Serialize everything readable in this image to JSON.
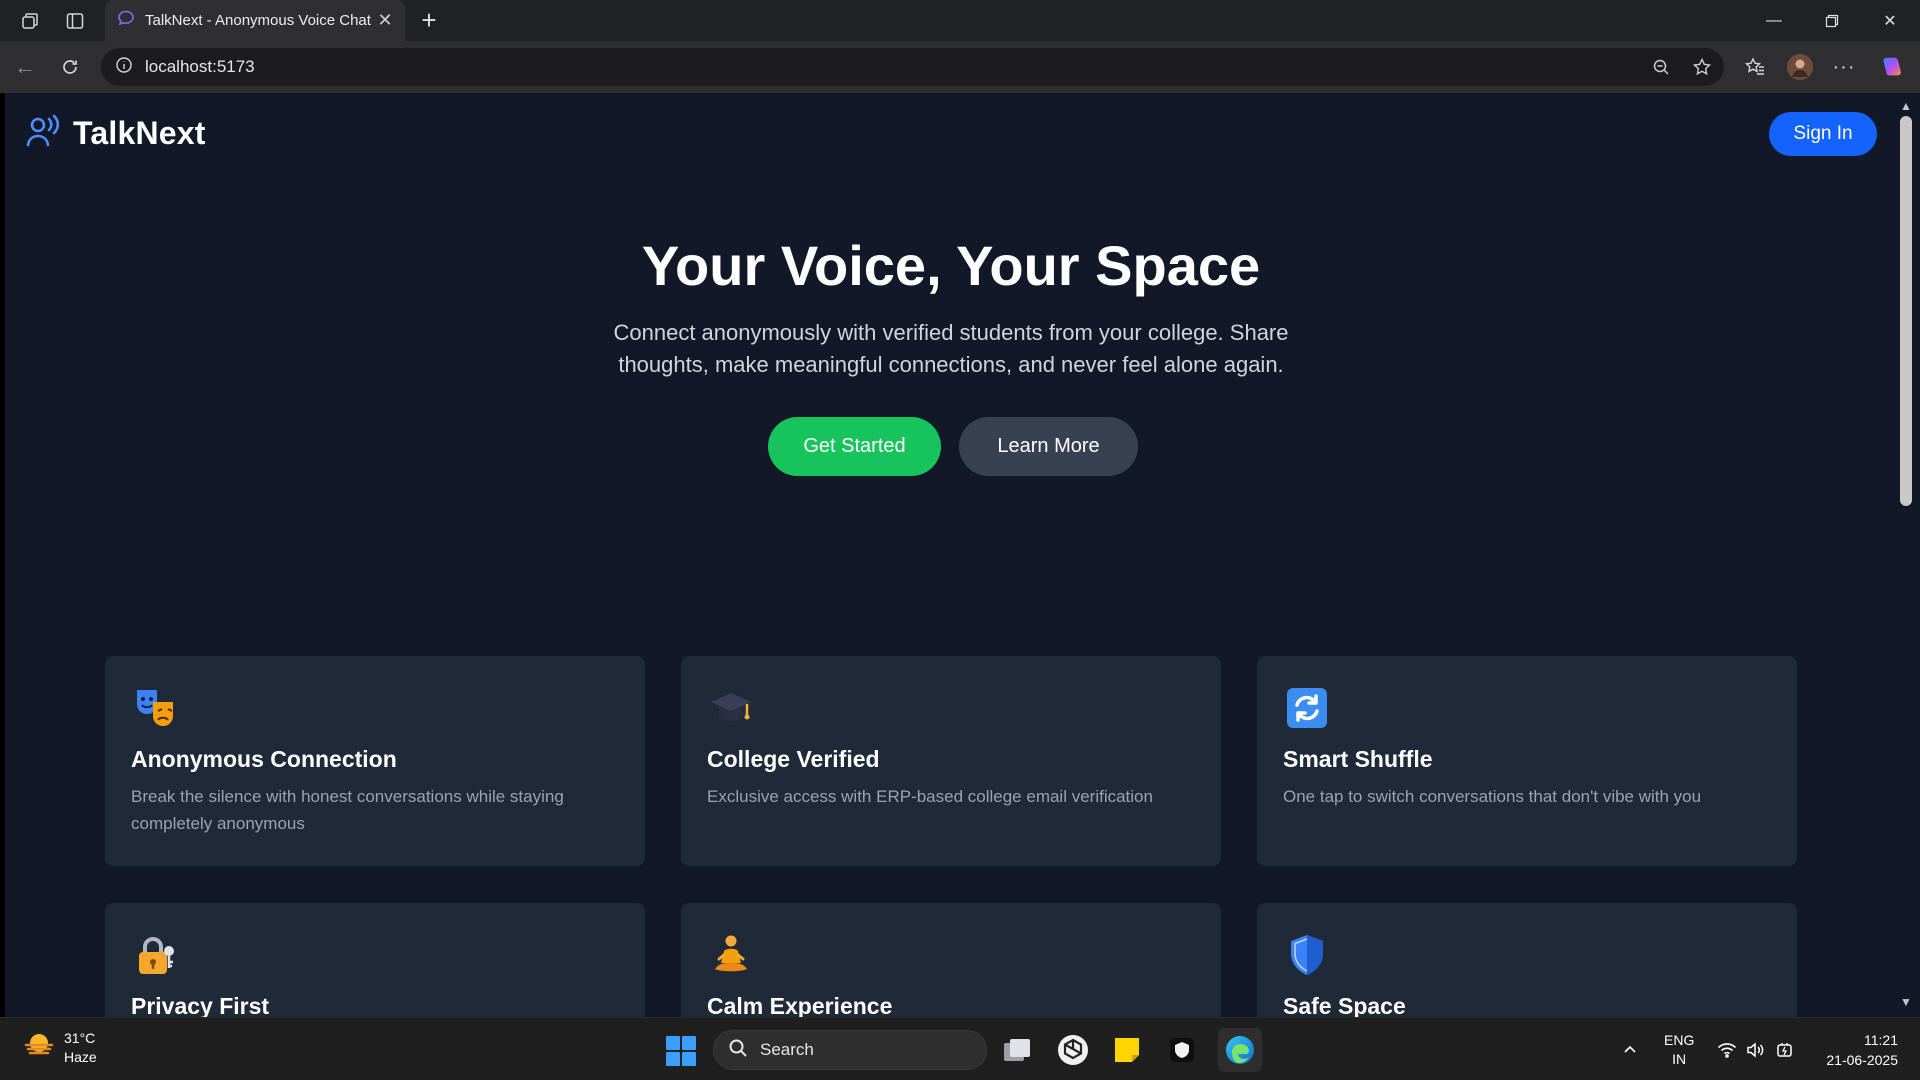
{
  "browser": {
    "tab_title": "TalkNext - Anonymous Voice Chat",
    "url": "localhost:5173"
  },
  "page": {
    "brand": "TalkNext",
    "sign_in_label": "Sign In",
    "hero": {
      "title": "Your Voice, Your Space",
      "subtitle": "Connect anonymously with verified students from your college. Share thoughts, make meaningful connections, and never feel alone again.",
      "primary_cta": "Get Started",
      "secondary_cta": "Learn More"
    },
    "features": [
      {
        "icon": "theater-masks-icon",
        "title": "Anonymous Connection",
        "description": "Break the silence with honest conversations while staying completely anonymous"
      },
      {
        "icon": "graduation-cap-icon",
        "title": "College Verified",
        "description": "Exclusive access with ERP-based college email verification"
      },
      {
        "icon": "shuffle-icon",
        "title": "Smart Shuffle",
        "description": "One tap to switch conversations that don't vibe with you"
      },
      {
        "icon": "lock-icon",
        "title": "Privacy First",
        "description": ""
      },
      {
        "icon": "meditation-icon",
        "title": "Calm Experience",
        "description": ""
      },
      {
        "icon": "shield-icon",
        "title": "Safe Space",
        "description": ""
      }
    ],
    "colors": {
      "background": "#111827",
      "card": "#1f2937",
      "primary": "#1463ff",
      "success": "#16c45b"
    }
  },
  "taskbar": {
    "weather_temp": "31°C",
    "weather_desc": "Haze",
    "search_label": "Search",
    "lang_1": "ENG",
    "lang_2": "IN",
    "time": "11:21",
    "date": "21-06-2025"
  }
}
